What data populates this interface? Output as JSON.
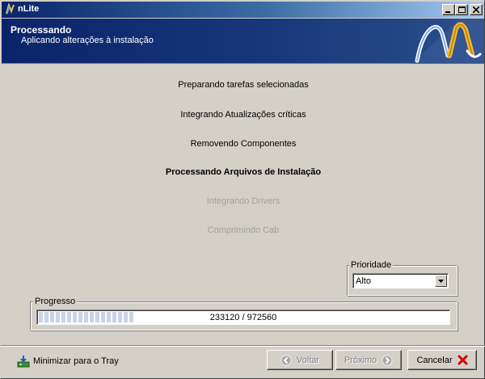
{
  "window": {
    "title": "nLite",
    "controls": [
      "minimize-icon",
      "maximize-icon",
      "close-icon"
    ]
  },
  "header": {
    "title": "Processando",
    "subtitle": "Aplicando alterações à instalação",
    "logo": "nlite-logo"
  },
  "steps": [
    {
      "label": "Preparando tarefas selecionadas",
      "state": "done"
    },
    {
      "label": "Integrando Atualizações críticas",
      "state": "done"
    },
    {
      "label": "Removendo Componentes",
      "state": "done"
    },
    {
      "label": "Processando Arquivos de Instalação",
      "state": "active"
    },
    {
      "label": "Integrando Drivers",
      "state": "pending"
    },
    {
      "label": "Comprimindo Cab",
      "state": "pending"
    }
  ],
  "priority": {
    "label": "Prioridade",
    "value": "Alto"
  },
  "progress": {
    "label": "Progresso",
    "text": "233120 / 972560",
    "current": 233120,
    "total": 972560
  },
  "footer": {
    "tray_label": "Minimizar para o Tray",
    "back_label": "Voltar",
    "next_label": "Próximo",
    "cancel_label": "Cancelar"
  },
  "colors": {
    "header_bg": "#0a246a",
    "window_bg": "#d4d0c8",
    "cancel_icon": "#d40000"
  }
}
